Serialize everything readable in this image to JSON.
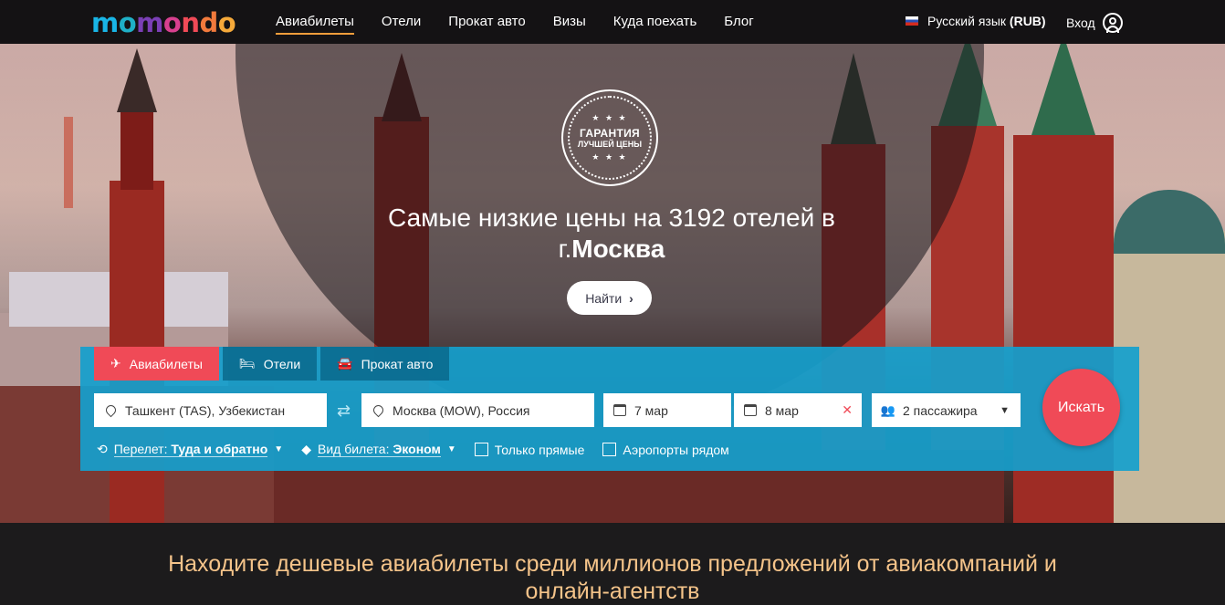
{
  "header": {
    "logo_text": "momondo",
    "nav": [
      {
        "label": "Авиабилеты",
        "active": true
      },
      {
        "label": "Отели",
        "active": false
      },
      {
        "label": "Прокат авто",
        "active": false
      },
      {
        "label": "Визы",
        "active": false
      },
      {
        "label": "Куда поехать",
        "active": false
      },
      {
        "label": "Блог",
        "active": false
      }
    ],
    "language_label": "Русский язык",
    "currency_label": "(RUB)",
    "login_label": "Вход"
  },
  "hero": {
    "badge_stars": "★ ★ ★",
    "badge_line1": "ГАРАНТИЯ",
    "badge_line2": "ЛУЧШЕЙ ЦЕНЫ",
    "title_prefix": "Самые низкие цены на 3192 отелей в г.",
    "title_city": "Москва",
    "find_button": "Найти"
  },
  "search": {
    "tabs": [
      {
        "label": "Авиабилеты",
        "icon": "plane-icon",
        "active": true
      },
      {
        "label": "Отели",
        "icon": "bed-icon",
        "active": false
      },
      {
        "label": "Прокат авто",
        "icon": "car-icon",
        "active": false
      }
    ],
    "origin": "Ташкент (TAS), Узбекистан",
    "destination": "Москва (MOW), Россия",
    "depart_date": "7 мар",
    "return_date": "8 мар",
    "passengers": "2 пассажира",
    "search_button": "Искать",
    "trip_type_label": "Перелет:",
    "trip_type_value": "Туда и обратно",
    "class_label": "Вид билета:",
    "class_value": "Эконом",
    "direct_only_label": "Только прямые",
    "nearby_airports_label": "Аэропорты рядом"
  },
  "footer_banner": {
    "text": "Находите дешевые авиабилеты среди миллионов предложений от авиакомпаний и онлайн-агентств"
  },
  "colors": {
    "accent": "#f04a57",
    "panel": "#15a0cd",
    "nav_underline": "#f59d3c",
    "banner_text": "#f5c48a"
  }
}
